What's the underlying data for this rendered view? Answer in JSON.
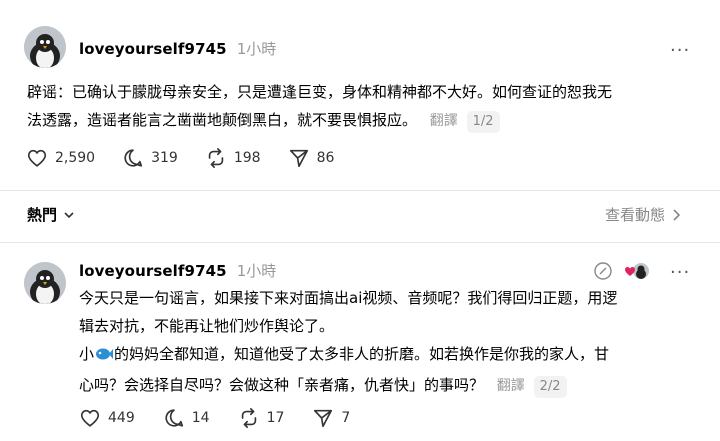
{
  "post1": {
    "username": "loveyourself9745",
    "time": "1小時",
    "more_icon": "more-icon",
    "text_line1": "辟谣：已确认于朦胧母亲安全，只是遭逢巨变，身体和精神都不大好。如何查证的恕我无",
    "text_line2": "法透露，造谣者能言之凿凿地颠倒黑白，就不要畏惧报应。",
    "translate": "翻譯",
    "pager": "1/2",
    "likes": "2,590",
    "comments": "319",
    "reposts": "198",
    "shares": "86"
  },
  "section": {
    "hot_label": "熱門",
    "view_activity": "查看動態"
  },
  "post2": {
    "username": "loveyourself9745",
    "time": "1小時",
    "p1_line1": "今天只是一句谣言，如果接下来对面搞出ai视频、音频呢？我们得回归正题，用逻",
    "p1_line2": "辑去对抗，不能再让牠们炒作舆论了。",
    "p2_line1_pre": "小",
    "p2_line1_post": "的妈妈全都知道，知道他受了太多非人的折磨。如若换作是你我的家人，甘",
    "p2_line2": "心吗？会选择自尽吗？会做这种「亲者痛，仇者快」的事吗？",
    "translate": "翻譯",
    "pager": "2/2",
    "likes": "449",
    "comments": "14",
    "reposts": "17",
    "shares": "7"
  },
  "colors": {
    "muted": "#999999",
    "divider": "#e5e5e5",
    "fish": "#2b8fd6",
    "heart": "#e0245e"
  }
}
